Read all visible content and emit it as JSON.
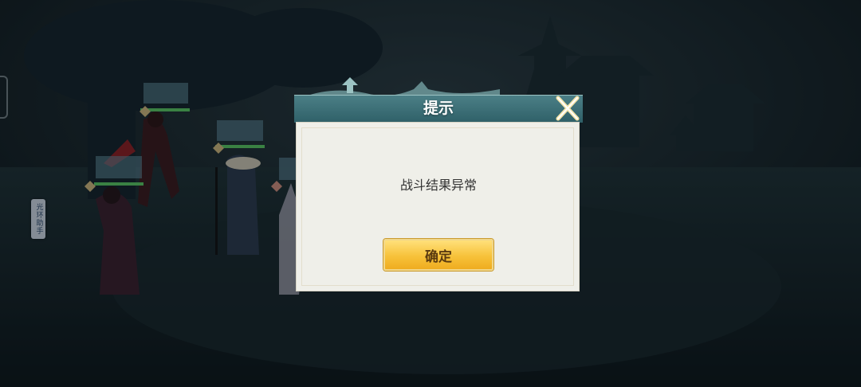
{
  "side_tab": {
    "label": "光环助手"
  },
  "dialog": {
    "title": "提示",
    "message": "战斗结果异常",
    "confirm_label": "确定"
  },
  "icons": {
    "close": "close-x-icon",
    "side_edge": "side-handle-icon"
  },
  "colors": {
    "header": "#3f7078",
    "body": "#efefe9",
    "button": "#f7c23a",
    "background": "#0f1a1f"
  }
}
